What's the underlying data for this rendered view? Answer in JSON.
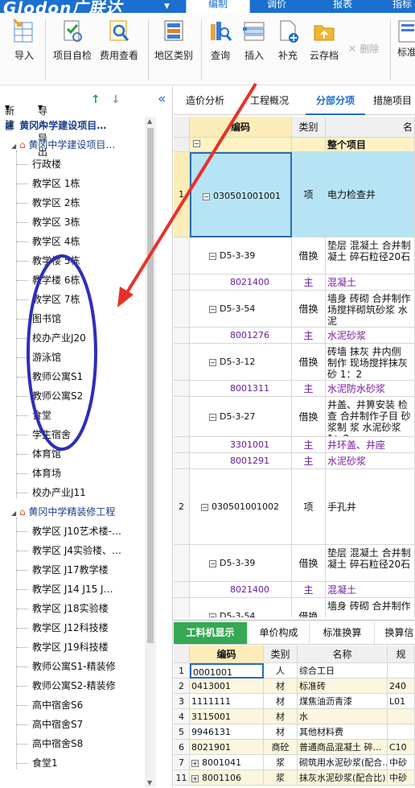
{
  "app": {
    "logo": "Glodon广联达",
    "menu_tabs": [
      "编制",
      "调价",
      "报表",
      "指标"
    ],
    "active_tab": 0
  },
  "ribbon": {
    "buttons": [
      {
        "label": "导入",
        "icon": "import-icon"
      },
      {
        "label": "项目自检",
        "icon": "project-check-icon"
      },
      {
        "label": "费用查看",
        "icon": "cost-view-icon"
      },
      {
        "label": "地区类别",
        "icon": "region-category-icon"
      },
      {
        "label": "查询",
        "icon": "query-icon"
      },
      {
        "label": "插入",
        "icon": "insert-icon"
      },
      {
        "label": "补充",
        "icon": "supplement-icon"
      },
      {
        "label": "云存档",
        "icon": "cloud-archive-icon"
      },
      {
        "label": "删除",
        "icon": "delete-icon"
      },
      {
        "label": "标准",
        "icon": "standard-icon"
      }
    ]
  },
  "left_panel": {
    "new_label": "新建",
    "io_label": "导入导出",
    "collapse_glyph": "«",
    "root": "黄冈中学建设项目…",
    "groups": [
      {
        "name": "黄冈中学建设项目…",
        "items": [
          "行政楼",
          "教学区 1栋",
          "教学区 2栋",
          "教学区 3栋",
          "教学区 4栋",
          "教学楼 5栋",
          "教学楼 6栋",
          "教学区 7栋",
          "图书馆",
          "校办产业J20",
          "游泳馆",
          "教师公寓S1",
          "教师公寓S2",
          "食堂",
          "学生宿舍",
          "体育馆",
          "体育场",
          "校办产业J11"
        ]
      },
      {
        "name": "黄冈中学精装修工程",
        "items": [
          "教学区 J10艺术楼-…",
          "教学区 J4实验楼、…",
          "教学区 J17教学楼",
          "教学区 J14 J15 J…",
          "教学区 J18实验楼",
          "教学区 J12科技楼",
          "教学区 J19科技楼",
          "教师公寓S1-精装修",
          "教师公寓S2-精装修",
          "高中宿舍S6",
          "高中宿舍S7",
          "高中宿舍S8",
          "食堂1"
        ]
      }
    ]
  },
  "right_panel": {
    "tabs": [
      "造价分析",
      "工程概况",
      "分部分项",
      "措施项目"
    ],
    "active_tab": 2,
    "grid": {
      "headers": [
        "编码",
        "类别",
        "名"
      ],
      "section_row": "整个项目",
      "rows": [
        {
          "num": "1",
          "code": "030501001001",
          "type": "项",
          "desc": "电力检查井",
          "level": "main"
        },
        {
          "num": "",
          "code": "D5-3-39",
          "type": "借换",
          "desc": "垫层 混凝土 合并制 凝土 碎石粒径20石",
          "level": "sub"
        },
        {
          "num": "",
          "code": "8021400",
          "type": "主",
          "desc": "混凝土",
          "level": "mat"
        },
        {
          "num": "",
          "code": "D5-3-54",
          "type": "借换",
          "desc": "墙身 砖砌 合并制作 场搅拌砌筑砂浆 水泥",
          "level": "sub"
        },
        {
          "num": "",
          "code": "8001276",
          "type": "主",
          "desc": "水泥砂浆",
          "level": "mat"
        },
        {
          "num": "",
          "code": "D5-3-12",
          "type": "借换",
          "desc": "砖墙 抹灰 井内侧 制作 现场搅拌抹灰砂 1：2",
          "level": "sub"
        },
        {
          "num": "",
          "code": "8001311",
          "type": "主",
          "desc": "水泥防水砂浆",
          "level": "mat"
        },
        {
          "num": "",
          "code": "D5-3-27",
          "type": "借换",
          "desc": "井盖、井箅安装 检查 合并制作子目 砂浆制 浆 水泥砂浆 1：2",
          "level": "sub"
        },
        {
          "num": "",
          "code": "3301001",
          "type": "主",
          "desc": "井环盖、井座",
          "level": "mat"
        },
        {
          "num": "",
          "code": "8001291",
          "type": "主",
          "desc": "水泥砂浆",
          "level": "mat"
        },
        {
          "num": "2",
          "code": "030501001002",
          "type": "项",
          "desc": "手孔井",
          "level": "main"
        },
        {
          "num": "",
          "code": "D5-3-39",
          "type": "借换",
          "desc": "垫层 混凝土 合并制 凝土 碎石粒径20石",
          "level": "sub"
        },
        {
          "num": "",
          "code": "8021400",
          "type": "主",
          "desc": "混凝土",
          "level": "mat"
        },
        {
          "num": "",
          "code": "D5-3-54",
          "type": "借换",
          "desc": "墙身 砖砌 合并制作",
          "level": "sub"
        }
      ]
    },
    "bottom": {
      "tabs": [
        "工料机显示",
        "单价构成",
        "标准换算",
        "换算信"
      ],
      "active_tab": 0,
      "headers": [
        "编码",
        "类别",
        "名称",
        "规"
      ],
      "rows": [
        {
          "num": "1",
          "code": "0001001",
          "type": "人",
          "name": "综合工日",
          "spec": ""
        },
        {
          "num": "2",
          "code": "0413001",
          "type": "材",
          "name": "标准砖",
          "spec": "240"
        },
        {
          "num": "3",
          "code": "1111111",
          "type": "材",
          "name": "煤焦油沥青漆",
          "spec": "L01"
        },
        {
          "num": "4",
          "code": "3115001",
          "type": "材",
          "name": "水",
          "spec": ""
        },
        {
          "num": "5",
          "code": "9946131",
          "type": "材",
          "name": "其他材料费",
          "spec": ""
        },
        {
          "num": "6",
          "code": "8021901",
          "type": "商砼",
          "name": "普通商品混凝土 碎…",
          "spec": "C10"
        },
        {
          "num": "7",
          "code": "8001041",
          "type": "浆",
          "name": "砌筑用水泥砂浆(配合…",
          "spec": "中砂"
        },
        {
          "num": "11",
          "code": "8001106",
          "type": "浆",
          "name": "抹灰水泥砂浆(配合比)",
          "spec": "中砂"
        }
      ]
    }
  },
  "colors": {
    "brand": "#1b6fd0",
    "selected": "#b7e4f5",
    "section": "#fff2c4",
    "green_tab": "#34a853",
    "annotation_ellipse": "#2e2eb8",
    "annotation_arrow": "#e8302a"
  }
}
